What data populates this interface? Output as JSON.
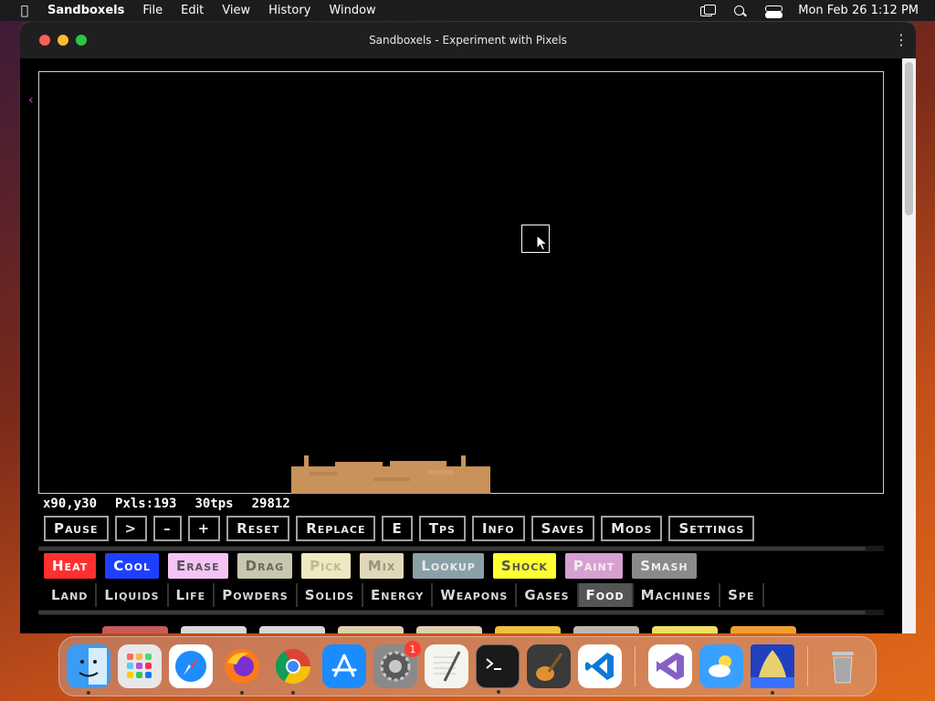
{
  "menubar": {
    "app_name": "Sandboxels",
    "menus": [
      "File",
      "Edit",
      "View",
      "History",
      "Window"
    ],
    "clock": "Mon Feb 26  1:12 PM"
  },
  "window": {
    "title": "Sandboxels - Experiment with Pixels"
  },
  "game": {
    "stats": {
      "coords": "x90,y30",
      "pixels": "Pxls:193",
      "tps": "30tps",
      "counter": "29812"
    },
    "controls": [
      "Pause",
      ">",
      "–",
      "+",
      "Reset",
      "Replace",
      "E",
      "Tps",
      "Info",
      "Saves",
      "Mods",
      "Settings"
    ],
    "tools": [
      {
        "label": "Heat",
        "bg": "#ff3030",
        "fg": "#ffffff"
      },
      {
        "label": "Cool",
        "bg": "#1f3fff",
        "fg": "#ffffff"
      },
      {
        "label": "Erase",
        "bg": "#f4c4f4",
        "fg": "#555555"
      },
      {
        "label": "Drag",
        "bg": "#c8c8b0",
        "fg": "#6a6a60"
      },
      {
        "label": "Pick",
        "bg": "#f0e8c0",
        "fg": "#c0b890"
      },
      {
        "label": "Mix",
        "bg": "#e0d8b8",
        "fg": "#9a9280"
      },
      {
        "label": "Lookup",
        "bg": "#8aa0a8",
        "fg": "#e8e8e8"
      },
      {
        "label": "Shock",
        "bg": "#ffff33",
        "fg": "#555555"
      },
      {
        "label": "Paint",
        "bg": "#d6a0d0",
        "fg": "#f0f0f0"
      },
      {
        "label": "Smash",
        "bg": "#8a8a8a",
        "fg": "#eeeeee"
      }
    ],
    "categories": [
      "Land",
      "Liquids",
      "Life",
      "Powders",
      "Solids",
      "Energy",
      "Weapons",
      "Gases",
      "Food",
      "Machines",
      "Spe"
    ],
    "active_category": "Food"
  },
  "colors": {
    "sand": "#c8925a",
    "sand_dark": "#a87040",
    "canvas_bg": "#000000"
  },
  "dock": {
    "apps": [
      {
        "name": "finder-icon",
        "bg": "#3a9cf5"
      },
      {
        "name": "launchpad-icon",
        "bg": "#e8e8e8"
      },
      {
        "name": "safari-icon",
        "bg": "#ffffff"
      },
      {
        "name": "firefox-icon",
        "bg": "#ff7a18"
      },
      {
        "name": "chrome-icon",
        "bg": "#ffffff"
      },
      {
        "name": "app-store-icon",
        "bg": "#1a8cff"
      },
      {
        "name": "system-settings-icon",
        "bg": "#8a8a8a",
        "badge": "1"
      },
      {
        "name": "textedit-icon",
        "bg": "#f5f5f0"
      },
      {
        "name": "terminal-icon",
        "bg": "#1a1a1a"
      },
      {
        "name": "garageband-icon",
        "bg": "#3a3a3a"
      },
      {
        "name": "vscode-icon",
        "bg": "#ffffff"
      },
      {
        "name": "visual-studio-icon",
        "bg": "#ffffff"
      },
      {
        "name": "weather-icon",
        "bg": "#3aa0ff"
      },
      {
        "name": "sandboxels-app-icon",
        "bg": "#2040c0"
      },
      {
        "name": "trash-icon",
        "bg": "#9a9a9a"
      }
    ]
  }
}
